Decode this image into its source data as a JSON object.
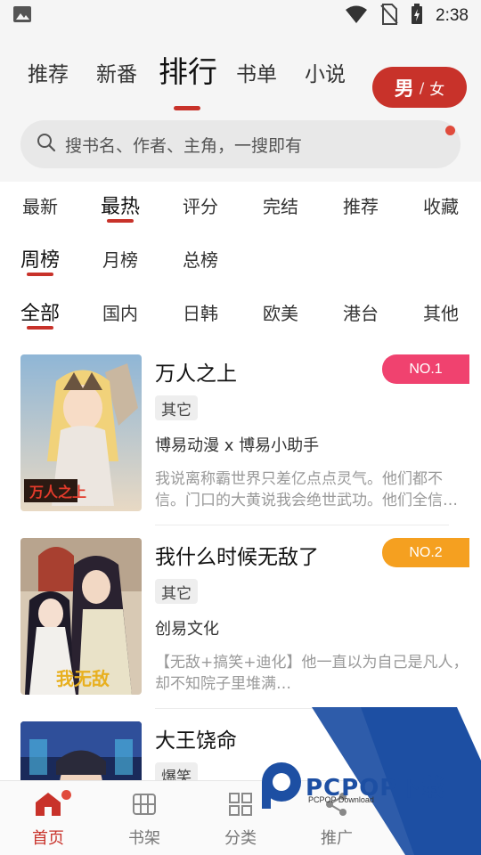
{
  "status_bar": {
    "time": "2:38"
  },
  "top_tabs": [
    {
      "label": "推荐"
    },
    {
      "label": "新番"
    },
    {
      "label": "排行"
    },
    {
      "label": "书单"
    },
    {
      "label": "小说"
    }
  ],
  "active_top_tab": "排行",
  "gender_toggle": {
    "male": "男",
    "separator": "/",
    "female": "女"
  },
  "search": {
    "placeholder": "搜书名、作者、主角，一搜即有"
  },
  "sort_filters": [
    "最新",
    "最热",
    "评分",
    "完结",
    "推荐",
    "收藏"
  ],
  "active_sort": "最热",
  "period_filters": [
    "周榜",
    "月榜",
    "总榜"
  ],
  "active_period": "周榜",
  "region_filters": [
    "全部",
    "国内",
    "日韩",
    "欧美",
    "港台",
    "其他"
  ],
  "active_region": "全部",
  "books": [
    {
      "title": "万人之上",
      "rank": "NO.1",
      "tag": "其它",
      "author": "博易动漫 x 博易小助手",
      "description": "我说离称霸世界只差亿点点灵气。他们都不信。门口的大黄说我会绝世武功。他们全信…"
    },
    {
      "title": "我什么时候无敌了",
      "rank": "NO.2",
      "tag": "其它",
      "author": "创易文化",
      "description": "【无敌+搞笑+迪化】他一直以为自己是凡人，却不知院子里堆满…"
    },
    {
      "title": "大王饶命",
      "rank": "",
      "tag": "爆笑",
      "author": "",
      "description": ""
    }
  ],
  "bottom_nav": [
    {
      "label": "首页",
      "icon": "home-icon"
    },
    {
      "label": "书架",
      "icon": "bookshelf-icon"
    },
    {
      "label": "分类",
      "icon": "category-icon"
    },
    {
      "label": "推广",
      "icon": "share-icon"
    }
  ],
  "watermark": {
    "text": "PCPOP下载",
    "subtext": "PCPOP Download"
  },
  "colors": {
    "accent": "#c8322a",
    "rank1": "#f0426f",
    "rank2": "#f5a020",
    "header_bg": "#f5f5f5"
  }
}
